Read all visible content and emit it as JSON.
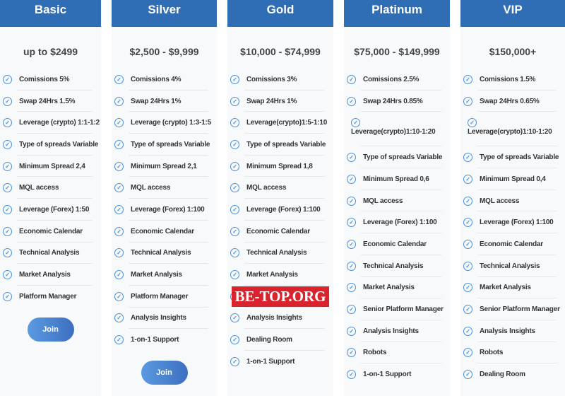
{
  "plans": [
    {
      "name": "Basic",
      "price": "up to $2499",
      "features": [
        "Comissions 5%",
        "Swap 24Hrs 1.5%",
        "Leverage (crypto) 1:1-1:2",
        "Type of spreads Variable",
        "Minimum Spread 2,4",
        "MQL access",
        "Leverage (Forex) 1:50",
        "Economic Calendar",
        "Technical Analysis",
        "Market Analysis",
        "Platform Manager"
      ],
      "join": "Join"
    },
    {
      "name": "Silver",
      "price": "$2,500 - $9,999",
      "features": [
        "Comissions 4%",
        "Swap 24Hrs 1%",
        "Leverage (crypto) 1:3-1:5",
        "Type of spreads Variable",
        "Minimum Spread 2,1",
        "MQL access",
        "Leverage (Forex) 1:100",
        "Economic Calendar",
        "Technical Analysis",
        "Market Analysis",
        "Platform Manager",
        "Analysis Insights",
        "1-on-1 Support"
      ],
      "join": "Join"
    },
    {
      "name": "Gold",
      "price": "$10,000 - $74,999",
      "features": [
        "Comissions 3%",
        "Swap 24Hrs 1%",
        "Leverage(crypto)1:5-1:10",
        "Type of spreads Variable",
        "Minimum Spread 1,8",
        "MQL access",
        "Leverage (Forex) 1:100",
        "Economic Calendar",
        "Technical Analysis",
        "Market Analysis",
        "",
        "Analysis Insights",
        "Dealing Room",
        "1-on-1 Support"
      ]
    },
    {
      "name": "Platinum",
      "price": "$75,000 - $149,999",
      "features": [
        "Comissions 2.5%",
        "Swap 24Hrs 0.85%",
        "Leverage(crypto)1:10-1:20",
        "Type of spreads Variable",
        "Minimum Spread 0,6",
        "MQL access",
        "Leverage (Forex) 1:100",
        "Economic Calendar",
        "Technical Analysis",
        "Market Analysis",
        "Senior Platform Manager",
        "Analysis Insights",
        "Robots",
        "1-on-1 Support"
      ]
    },
    {
      "name": "VIP",
      "price": "$150,000+",
      "features": [
        "Comissions 1.5%",
        "Swap 24Hrs 0.65%",
        "Leverage(crypto)1:10-1:20",
        "Type of spreads Variable",
        "Minimum Spread 0,4",
        "MQL access",
        "Leverage (Forex) 1:100",
        "Economic Calendar",
        "Technical Analysis",
        "Market Analysis",
        "Senior Platform Manager",
        "Analysis Insights",
        "Robots",
        "Dealing Room"
      ]
    }
  ],
  "watermark": "BE-TOP.ORG",
  "colors": {
    "header": "#2f6db5",
    "check": "#4a90d9",
    "watermark": "#d9232d"
  },
  "icons": {
    "feature": "check-circle-icon"
  }
}
